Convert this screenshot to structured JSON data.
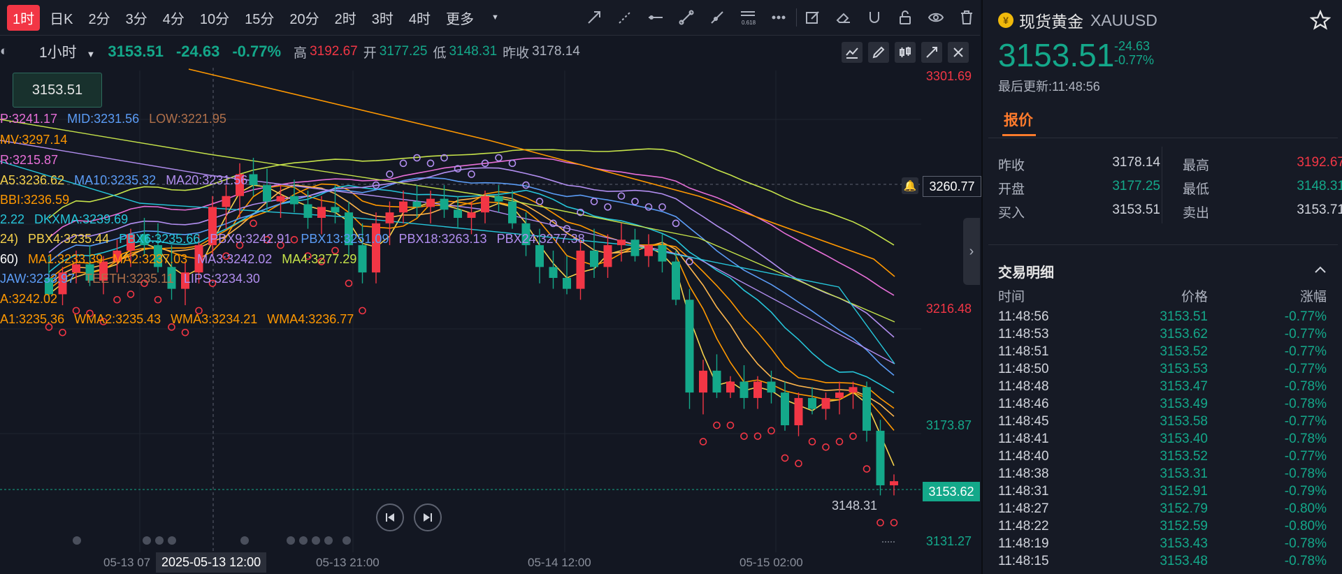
{
  "periods": [
    "1时",
    "日K",
    "2分",
    "3分",
    "4分",
    "10分",
    "15分",
    "20分",
    "2时",
    "3时",
    "4时",
    "更多"
  ],
  "active_period": "1时",
  "fib_label": "0.618",
  "info": {
    "interval": "1小时",
    "price": "3153.51",
    "change": "-24.63",
    "change_pct": "-0.77%",
    "high_label": "高",
    "high": "3192.67",
    "open_label": "开",
    "open": "3177.25",
    "low_label": "低",
    "low": "3148.31",
    "prev_label": "昨收",
    "prev": "3178.14"
  },
  "crosshair_price": "3153.51",
  "legend_lines": [
    {
      "items": [
        {
          "t": "P:3241.17",
          "c": "#e76fd8"
        },
        {
          "t": "MID:3231.56",
          "c": "#5b9cf6"
        },
        {
          "t": "LOW:3221.95",
          "c": "#b0704a"
        }
      ]
    },
    {
      "items": [
        {
          "t": "MV:3297.14",
          "c": "#ff9800"
        }
      ]
    },
    {
      "items": [
        {
          "t": "R:3215.87",
          "c": "#e76fd8"
        }
      ]
    },
    {
      "items": [
        {
          "t": "A5:3236.62",
          "c": "#f5d14b"
        },
        {
          "t": "MA10:3235.32",
          "c": "#5b9cf6"
        },
        {
          "t": "MA20:3231.56",
          "c": "#b28ef0"
        }
      ]
    },
    {
      "items": [
        {
          "t": "BBI:3236.59",
          "c": "#ff9800"
        }
      ]
    },
    {
      "items": [
        {
          "t": "2.22",
          "c": "#26c6da"
        },
        {
          "t": "DKXMA:3239.69",
          "c": "#26c6da"
        }
      ]
    },
    {
      "items": [
        {
          "t": "24)",
          "c": "#f5d14b"
        },
        {
          "t": "PBX4:3235.44",
          "c": "#f5d14b"
        },
        {
          "t": "PBX6:3235.66",
          "c": "#26c6da"
        },
        {
          "t": "PBX9:3242.91",
          "c": "#b28ef0"
        },
        {
          "t": "PBX13:3251.09",
          "c": "#5b9cf6"
        },
        {
          "t": "PBX18:3263.13",
          "c": "#b28ef0"
        },
        {
          "t": "PBX24:3277.38",
          "c": "#b28ef0"
        }
      ]
    },
    {
      "items": [
        {
          "t": "60)",
          "c": "#ffffff"
        },
        {
          "t": "MA1:3233.39",
          "c": "#ff9800"
        },
        {
          "t": "MA2:3237.03",
          "c": "#ff9800"
        },
        {
          "t": "MA3:3242.02",
          "c": "#b28ef0"
        },
        {
          "t": "MA4:3277.29",
          "c": "#c6e34a"
        }
      ]
    },
    {
      "items": [
        {
          "t": "JAW:3233.97",
          "c": "#5b9cf6"
        },
        {
          "t": "TEETH:3235.11",
          "c": "#b0704a"
        },
        {
          "t": "LIPS:3234.30",
          "c": "#b28ef0"
        }
      ]
    },
    {
      "items": [
        {
          "t": "A:3242.02",
          "c": "#ff9800"
        }
      ]
    },
    {
      "items": [
        {
          "t": "A1:3235.36",
          "c": "#ff9800"
        },
        {
          "t": "WMA2:3235.43",
          "c": "#ff9800"
        },
        {
          "t": "WMA3:3234.21",
          "c": "#ff9800"
        },
        {
          "t": "WMA4:3236.77",
          "c": "#ff9800"
        }
      ]
    }
  ],
  "y_ticks": [
    {
      "v": "3301.69",
      "c": "up"
    },
    {
      "v": "3216.48",
      "c": "up"
    },
    {
      "v": "3173.87",
      "c": "g"
    },
    {
      "v": "3131.27",
      "c": "g"
    }
  ],
  "line_tag": "3260.77",
  "price_tag": "3153.62",
  "low_marker": "3148.31",
  "x_ticks": [
    "05-13 07",
    "05-13 21:00",
    "05-14 12:00",
    "05-15 02:00"
  ],
  "crosshair_date": "2025-05-13 12:00",
  "chart_data": {
    "type": "candlestick",
    "ylim": [
      3131.27,
      3301.69
    ],
    "candles": [
      {
        "o": 3228,
        "h": 3236,
        "l": 3220,
        "c": 3222
      },
      {
        "o": 3222,
        "h": 3232,
        "l": 3218,
        "c": 3230
      },
      {
        "o": 3230,
        "h": 3238,
        "l": 3226,
        "c": 3233
      },
      {
        "o": 3233,
        "h": 3240,
        "l": 3225,
        "c": 3227
      },
      {
        "o": 3227,
        "h": 3236,
        "l": 3222,
        "c": 3234
      },
      {
        "o": 3234,
        "h": 3242,
        "l": 3230,
        "c": 3238
      },
      {
        "o": 3238,
        "h": 3246,
        "l": 3232,
        "c": 3244
      },
      {
        "o": 3244,
        "h": 3250,
        "l": 3236,
        "c": 3240
      },
      {
        "o": 3240,
        "h": 3248,
        "l": 3230,
        "c": 3232
      },
      {
        "o": 3232,
        "h": 3240,
        "l": 3220,
        "c": 3224
      },
      {
        "o": 3224,
        "h": 3234,
        "l": 3218,
        "c": 3230
      },
      {
        "o": 3230,
        "h": 3244,
        "l": 3226,
        "c": 3240
      },
      {
        "o": 3240,
        "h": 3258,
        "l": 3236,
        "c": 3254
      },
      {
        "o": 3254,
        "h": 3262,
        "l": 3246,
        "c": 3258
      },
      {
        "o": 3258,
        "h": 3270,
        "l": 3250,
        "c": 3266
      },
      {
        "o": 3266,
        "h": 3272,
        "l": 3258,
        "c": 3262
      },
      {
        "o": 3262,
        "h": 3268,
        "l": 3252,
        "c": 3256
      },
      {
        "o": 3256,
        "h": 3262,
        "l": 3250,
        "c": 3258
      },
      {
        "o": 3258,
        "h": 3264,
        "l": 3252,
        "c": 3255
      },
      {
        "o": 3255,
        "h": 3260,
        "l": 3246,
        "c": 3250
      },
      {
        "o": 3250,
        "h": 3258,
        "l": 3244,
        "c": 3254
      },
      {
        "o": 3254,
        "h": 3262,
        "l": 3248,
        "c": 3252
      },
      {
        "o": 3252,
        "h": 3256,
        "l": 3236,
        "c": 3240
      },
      {
        "o": 3240,
        "h": 3248,
        "l": 3226,
        "c": 3230
      },
      {
        "o": 3230,
        "h": 3252,
        "l": 3226,
        "c": 3248
      },
      {
        "o": 3248,
        "h": 3256,
        "l": 3240,
        "c": 3252
      },
      {
        "o": 3252,
        "h": 3260,
        "l": 3248,
        "c": 3256
      },
      {
        "o": 3256,
        "h": 3262,
        "l": 3250,
        "c": 3254
      },
      {
        "o": 3254,
        "h": 3260,
        "l": 3248,
        "c": 3257
      },
      {
        "o": 3257,
        "h": 3262,
        "l": 3250,
        "c": 3253
      },
      {
        "o": 3253,
        "h": 3258,
        "l": 3246,
        "c": 3250
      },
      {
        "o": 3250,
        "h": 3256,
        "l": 3244,
        "c": 3252
      },
      {
        "o": 3252,
        "h": 3260,
        "l": 3248,
        "c": 3258
      },
      {
        "o": 3258,
        "h": 3262,
        "l": 3252,
        "c": 3256
      },
      {
        "o": 3256,
        "h": 3260,
        "l": 3246,
        "c": 3248
      },
      {
        "o": 3248,
        "h": 3252,
        "l": 3236,
        "c": 3240
      },
      {
        "o": 3240,
        "h": 3246,
        "l": 3226,
        "c": 3232
      },
      {
        "o": 3232,
        "h": 3238,
        "l": 3224,
        "c": 3228
      },
      {
        "o": 3228,
        "h": 3236,
        "l": 3222,
        "c": 3224
      },
      {
        "o": 3224,
        "h": 3242,
        "l": 3220,
        "c": 3238
      },
      {
        "o": 3238,
        "h": 3246,
        "l": 3228,
        "c": 3232
      },
      {
        "o": 3232,
        "h": 3244,
        "l": 3228,
        "c": 3240
      },
      {
        "o": 3240,
        "h": 3248,
        "l": 3234,
        "c": 3242
      },
      {
        "o": 3242,
        "h": 3246,
        "l": 3234,
        "c": 3236
      },
      {
        "o": 3236,
        "h": 3244,
        "l": 3232,
        "c": 3240
      },
      {
        "o": 3240,
        "h": 3244,
        "l": 3230,
        "c": 3234
      },
      {
        "o": 3234,
        "h": 3238,
        "l": 3218,
        "c": 3220
      },
      {
        "o": 3220,
        "h": 3224,
        "l": 3180,
        "c": 3186
      },
      {
        "o": 3186,
        "h": 3198,
        "l": 3178,
        "c": 3194
      },
      {
        "o": 3194,
        "h": 3200,
        "l": 3184,
        "c": 3186
      },
      {
        "o": 3186,
        "h": 3192,
        "l": 3184,
        "c": 3190
      },
      {
        "o": 3190,
        "h": 3196,
        "l": 3180,
        "c": 3184
      },
      {
        "o": 3184,
        "h": 3192,
        "l": 3180,
        "c": 3190
      },
      {
        "o": 3190,
        "h": 3194,
        "l": 3182,
        "c": 3186
      },
      {
        "o": 3186,
        "h": 3190,
        "l": 3172,
        "c": 3174
      },
      {
        "o": 3174,
        "h": 3186,
        "l": 3170,
        "c": 3184
      },
      {
        "o": 3184,
        "h": 3188,
        "l": 3178,
        "c": 3180
      },
      {
        "o": 3180,
        "h": 3186,
        "l": 3176,
        "c": 3184
      },
      {
        "o": 3184,
        "h": 3190,
        "l": 3178,
        "c": 3186
      },
      {
        "o": 3186,
        "h": 3190,
        "l": 3180,
        "c": 3188
      },
      {
        "o": 3188,
        "h": 3190,
        "l": 3168,
        "c": 3172
      },
      {
        "o": 3172,
        "h": 3176,
        "l": 3148.31,
        "c": 3152
      },
      {
        "o": 3152,
        "h": 3156,
        "l": 3148.31,
        "c": 3153.51
      }
    ]
  },
  "panel": {
    "symbol_name": "现货黄金",
    "symbol_code": "XAUUSD",
    "price": "3153.51",
    "change": "-24.63",
    "change_pct": "-0.77%",
    "updated": "最后更新:11:48:56",
    "tab": "报价",
    "quote": [
      [
        {
          "l": "昨收",
          "v": "3178.14",
          "c": "#d1d4dc"
        },
        {
          "l": "最高",
          "v": "3192.67",
          "c": "#f23645"
        }
      ],
      [
        {
          "l": "开盘",
          "v": "3177.25",
          "c": "#14a88a"
        },
        {
          "l": "最低",
          "v": "3148.31",
          "c": "#14a88a"
        }
      ],
      [
        {
          "l": "买入",
          "v": "3153.51",
          "c": "#d1d4dc"
        },
        {
          "l": "卖出",
          "v": "3153.71",
          "c": "#d1d4dc"
        }
      ]
    ],
    "trades_title": "交易明细",
    "trades_headers": [
      "时间",
      "价格",
      "涨幅"
    ],
    "trades": [
      [
        "11:48:56",
        "3153.51",
        "-0.77%"
      ],
      [
        "11:48:53",
        "3153.62",
        "-0.77%"
      ],
      [
        "11:48:51",
        "3153.52",
        "-0.77%"
      ],
      [
        "11:48:50",
        "3153.53",
        "-0.77%"
      ],
      [
        "11:48:48",
        "3153.47",
        "-0.78%"
      ],
      [
        "11:48:46",
        "3153.49",
        "-0.78%"
      ],
      [
        "11:48:45",
        "3153.58",
        "-0.77%"
      ],
      [
        "11:48:41",
        "3153.40",
        "-0.78%"
      ],
      [
        "11:48:40",
        "3153.52",
        "-0.77%"
      ],
      [
        "11:48:38",
        "3153.31",
        "-0.78%"
      ],
      [
        "11:48:31",
        "3152.91",
        "-0.79%"
      ],
      [
        "11:48:27",
        "3152.79",
        "-0.80%"
      ],
      [
        "11:48:22",
        "3152.59",
        "-0.80%"
      ],
      [
        "11:48:19",
        "3153.43",
        "-0.78%"
      ],
      [
        "11:48:15",
        "3153.48",
        "-0.78%"
      ]
    ]
  }
}
